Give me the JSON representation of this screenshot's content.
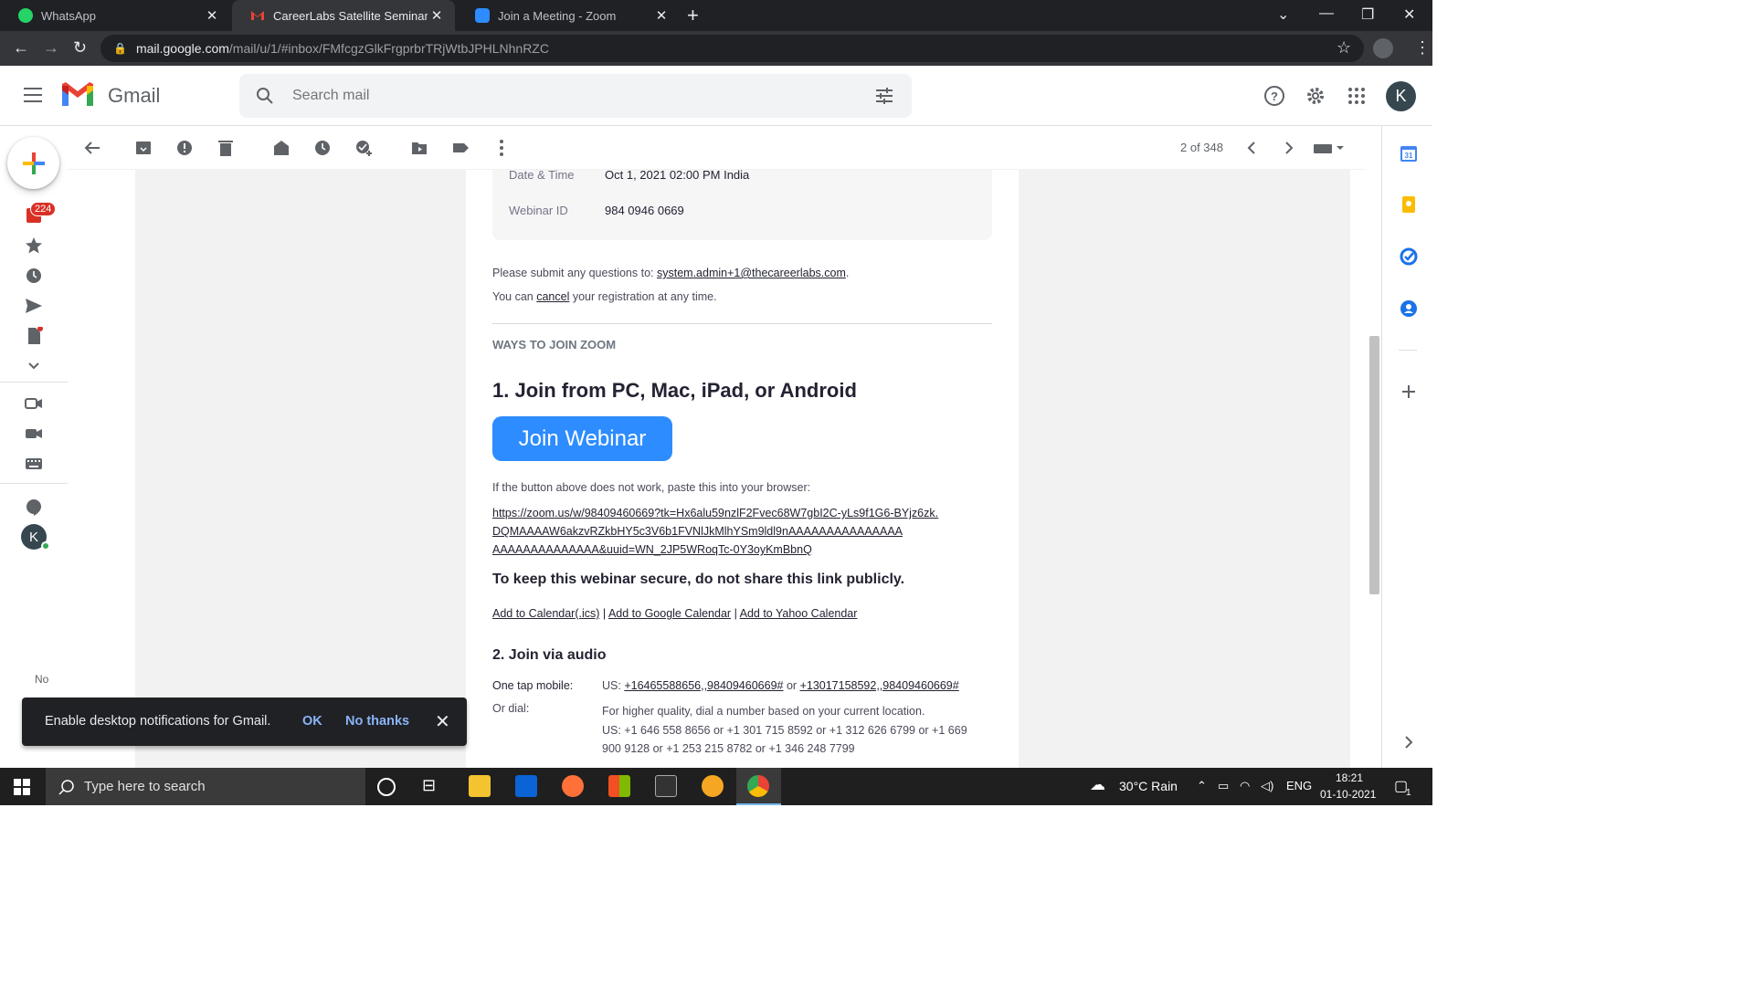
{
  "browser": {
    "tabs": [
      {
        "title": "WhatsApp",
        "icon": "whatsapp-icon"
      },
      {
        "title": "CareerLabs Satellite Seminar Con",
        "icon": "gmail-icon"
      },
      {
        "title": "Join a Meeting - Zoom",
        "icon": "zoom-icon"
      }
    ],
    "url_host": "mail.google.com",
    "url_path": "/mail/u/1/#inbox/FMfcgzGlkFrgprbrTRjWtbJPHLNhnRZC"
  },
  "gmail": {
    "brand": "Gmail",
    "search_placeholder": "Search mail",
    "avatar_letter": "K",
    "inbox_badge": "224",
    "pager": "2 of 348",
    "rail_text": "No",
    "accent": "#1a73e8"
  },
  "email": {
    "info": [
      {
        "label": "Date & Time",
        "value": "Oct 1, 2021 02:00 PM India"
      },
      {
        "label": "Webinar ID",
        "value": "984 0946 0669"
      }
    ],
    "questions_prefix": "Please submit any questions to:",
    "questions_email": "system.admin+1@thecareerlabs.com",
    "questions_suffix": ".",
    "cancel_prefix": "You can",
    "cancel_link": "cancel",
    "cancel_suffix": "your registration at any time.",
    "section_title": "WAYS TO JOIN ZOOM",
    "join_heading": "1. Join from PC, Mac, iPad, or Android",
    "join_button": "Join Webinar",
    "button_hint": "If the button above does not work, paste this into your browser:",
    "join_url_lines": [
      "https://zoom.us/w/98409460669?tk=Hx6alu59nzlF2Fvec68W7gbI2C-yLs9f1G6-BYjz6zk.",
      "DQMAAAAW6akzvRZkbHY5c3V6b1FVNlJkMlhYSm9ldl9nAAAAAAAAAAAAAAA",
      "AAAAAAAAAAAAAA&uuid=WN_2JP5WRoqTc-0Y3oyKmBbnQ"
    ],
    "secure_note": "To keep this webinar secure, do not share this link publicly.",
    "calendar_links": [
      "Add to Calendar(.ics)",
      "Add to Google Calendar",
      "Add to Yahoo Calendar"
    ],
    "calendar_sep": "|",
    "audio_heading": "2. Join via audio",
    "one_tap_label": "One tap mobile:",
    "one_tap_prefix": "US:",
    "one_tap_1": "+16465588656,,98409460669#",
    "one_tap_or": "or",
    "one_tap_2": "+13017158592,,98409460669#",
    "dial_label": "Or dial:",
    "dial_line1": "For higher quality, dial a number based on your current location.",
    "dial_line2": "US: +1 646 558 8656 or +1 301 715 8592 or +1 312 626 6799 or +1 669",
    "dial_line3": "900 9128 or +1 253 215 8782 or +1 346 248 7799",
    "zoom_blue": "#2d8cff"
  },
  "toast": {
    "message": "Enable desktop notifications for Gmail.",
    "ok": "OK",
    "no_thanks": "No thanks"
  },
  "taskbar": {
    "search_placeholder": "Type here to search",
    "weather": "30°C  Rain",
    "lang": "ENG",
    "time": "18:21",
    "date": "01-10-2021",
    "notif_count": "1"
  }
}
